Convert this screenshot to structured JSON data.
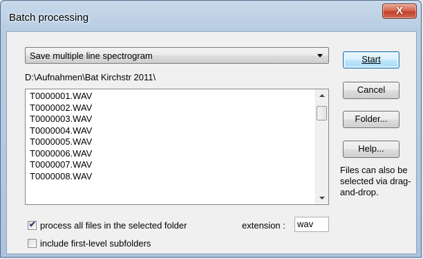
{
  "window": {
    "title": "Batch processing",
    "close_glyph": "X"
  },
  "action_combo": {
    "selected": "Save multiple line spectrogram"
  },
  "folder_path": "D:\\Aufnahmen\\Bat Kirchstr 2011\\",
  "files": [
    "T0000001.WAV",
    "T0000002.WAV",
    "T0000003.WAV",
    "T0000004.WAV",
    "T0000005.WAV",
    "T0000006.WAV",
    "T0000007.WAV",
    "T0000008.WAV"
  ],
  "buttons": {
    "start": "Start",
    "cancel": "Cancel",
    "folder": "Folder...",
    "help": "Help..."
  },
  "note": "Files can also be selected via drag-and-drop.",
  "options": {
    "process_all": {
      "label": "process all files in the selected folder",
      "checked": true
    },
    "subfolders": {
      "label": "include first-level subfolders",
      "checked": false
    }
  },
  "extension": {
    "label": "extension :",
    "value": "wav"
  }
}
